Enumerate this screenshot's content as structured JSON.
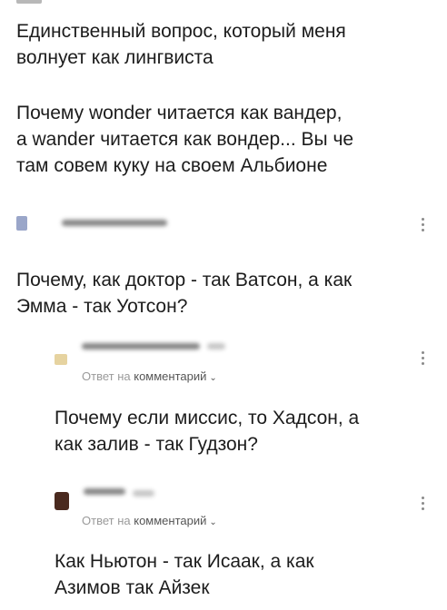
{
  "post": {
    "question": "Единственный вопрос, который меня\nволнует как лингвиста",
    "body": "Почему wonder читается как вандер,\nа wander читается как вондер... Вы че\nтам совем куку на своем Альбионе"
  },
  "comments": [
    {
      "text": "Почему, как доктор - так Ватсон, а как\nЭмма - так Уотсон?"
    }
  ],
  "replies": [
    {
      "meta_prefix": "Ответ на",
      "meta_link": "комментарий",
      "text": "Почему если миссис, то Хадсон, а\nкак залив - так Гудзон?"
    },
    {
      "meta_prefix": "Ответ на",
      "meta_link": "комментарий",
      "text": "Как Ньютон - так Исаак, а как\nАзимов так Айзек"
    }
  ],
  "icons": {
    "more": "more-vertical-icon",
    "expand": "chevron-down-icon"
  }
}
